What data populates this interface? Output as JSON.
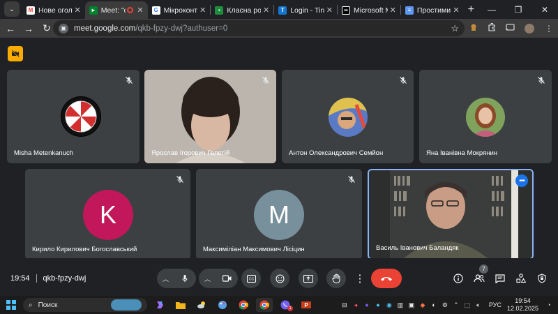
{
  "browser": {
    "tabs": [
      {
        "title": "Нове оголош",
        "favicon": "gmail-icon",
        "active": false
      },
      {
        "title": "Meet: \"qk",
        "favicon": "meet-icon",
        "active": true,
        "recording": true
      },
      {
        "title": "Мікроконтро",
        "favicon": "google-icon",
        "active": false
      },
      {
        "title": "Класна робот",
        "favicon": "classroom-icon",
        "active": false
      },
      {
        "title": "Login - Tinker",
        "favicon": "tinkercad-icon",
        "active": false
      },
      {
        "title": "Microsoft Ma",
        "favicon": "makecode-icon",
        "active": false
      },
      {
        "title": "Простими сл",
        "favicon": "translate-icon",
        "active": false
      }
    ],
    "url": {
      "host": "meet.google.com",
      "path": "/qkb-fpzy-dwj?authuser=0"
    }
  },
  "meet": {
    "participants": [
      {
        "name": "Misha Metenkanuch",
        "avatar": "umbrella-corporation-logo",
        "muted": true
      },
      {
        "name": "Ярослав Ігорович Гелетій",
        "avatar": "camera-video",
        "muted": true
      },
      {
        "name": "Антон Олександрович Семйон",
        "avatar": "photo-avatar",
        "muted": true
      },
      {
        "name": "Яна Іванівна Мокрянин",
        "avatar": "photo-avatar",
        "muted": true
      },
      {
        "name": "Кирило Кирилович Богославський",
        "avatar_letter": "K",
        "avatar_color": "#c2185b",
        "muted": true
      },
      {
        "name": "Максиміліан Максимович Лісіцин",
        "avatar_letter": "M",
        "avatar_color": "#78909c",
        "muted": true
      },
      {
        "name": "Василь Іванович Баландяк",
        "avatar": "camera-video",
        "active_speaker": true
      }
    ],
    "time": "19:54",
    "meeting_code": "qkb-fpzy-dwj",
    "people_count": "7",
    "accent_color": "#8ab4f8",
    "hangup_color": "#ea4335"
  },
  "taskbar": {
    "search_label": "Поиск",
    "language": "РУС",
    "clock_time": "19:54",
    "clock_date": "12.02.2025",
    "notification_count": "1"
  }
}
